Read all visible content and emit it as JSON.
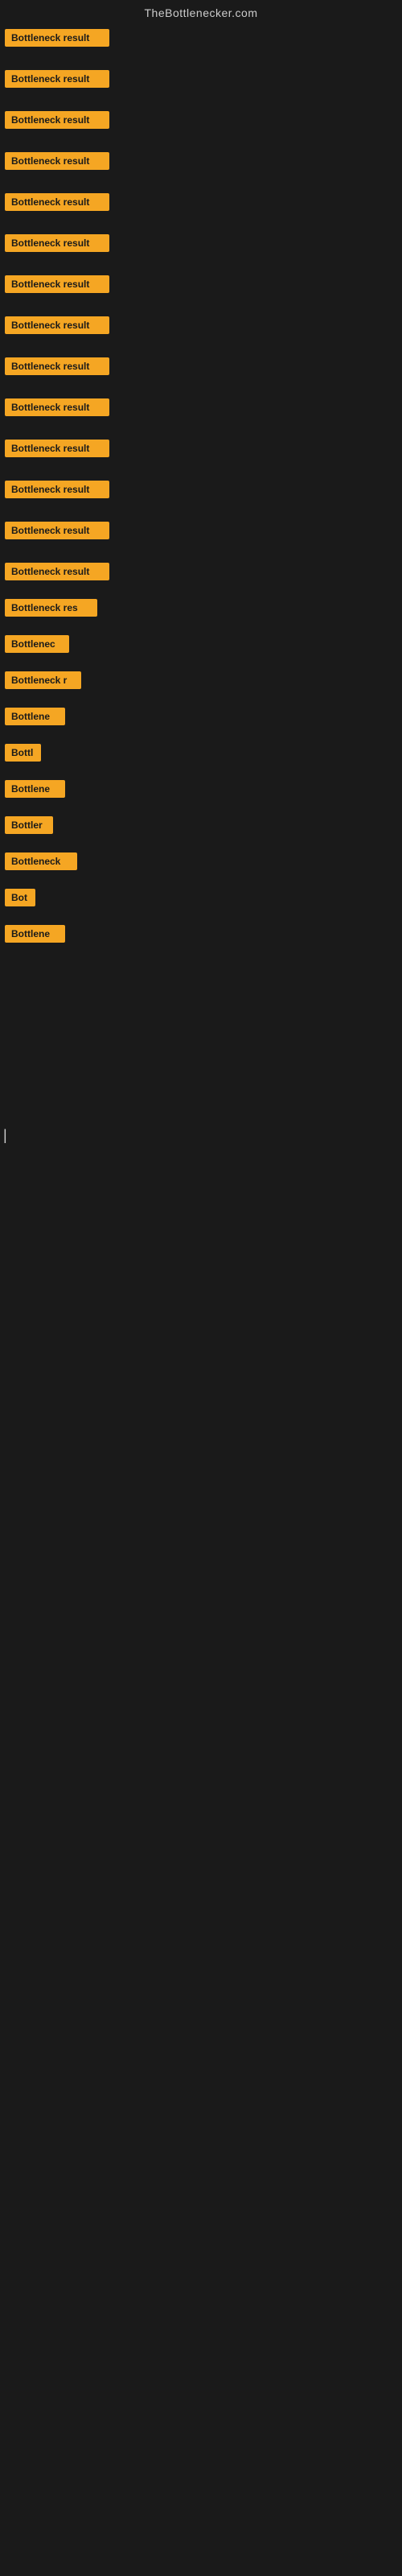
{
  "site": {
    "title": "TheBottlenecker.com"
  },
  "items": [
    {
      "id": 1,
      "label": "Bottleneck result",
      "width": "full"
    },
    {
      "id": 2,
      "label": "Bottleneck result",
      "width": "full"
    },
    {
      "id": 3,
      "label": "Bottleneck result",
      "width": "full"
    },
    {
      "id": 4,
      "label": "Bottleneck result",
      "width": "full"
    },
    {
      "id": 5,
      "label": "Bottleneck result",
      "width": "full"
    },
    {
      "id": 6,
      "label": "Bottleneck result",
      "width": "full"
    },
    {
      "id": 7,
      "label": "Bottleneck result",
      "width": "full"
    },
    {
      "id": 8,
      "label": "Bottleneck result",
      "width": "full"
    },
    {
      "id": 9,
      "label": "Bottleneck result",
      "width": "full"
    },
    {
      "id": 10,
      "label": "Bottleneck result",
      "width": "full"
    },
    {
      "id": 11,
      "label": "Bottleneck result",
      "width": "full"
    },
    {
      "id": 12,
      "label": "Bottleneck result",
      "width": "full"
    },
    {
      "id": 13,
      "label": "Bottleneck result",
      "width": "full"
    },
    {
      "id": 14,
      "label": "Bottleneck result",
      "width": "full"
    },
    {
      "id": 15,
      "label": "Bottleneck res",
      "width": "partial1"
    },
    {
      "id": 16,
      "label": "Bottlenec",
      "width": "partial2"
    },
    {
      "id": 17,
      "label": "Bottleneck r",
      "width": "partial3"
    },
    {
      "id": 18,
      "label": "Bottlene",
      "width": "partial4"
    },
    {
      "id": 19,
      "label": "Bottl",
      "width": "partial5"
    },
    {
      "id": 20,
      "label": "Bottlene",
      "width": "partial4"
    },
    {
      "id": 21,
      "label": "Bottler",
      "width": "partial6"
    },
    {
      "id": 22,
      "label": "Bottleneck",
      "width": "partial7"
    },
    {
      "id": 23,
      "label": "Bot",
      "width": "partial8"
    },
    {
      "id": 24,
      "label": "Bottlene",
      "width": "partial4"
    }
  ]
}
